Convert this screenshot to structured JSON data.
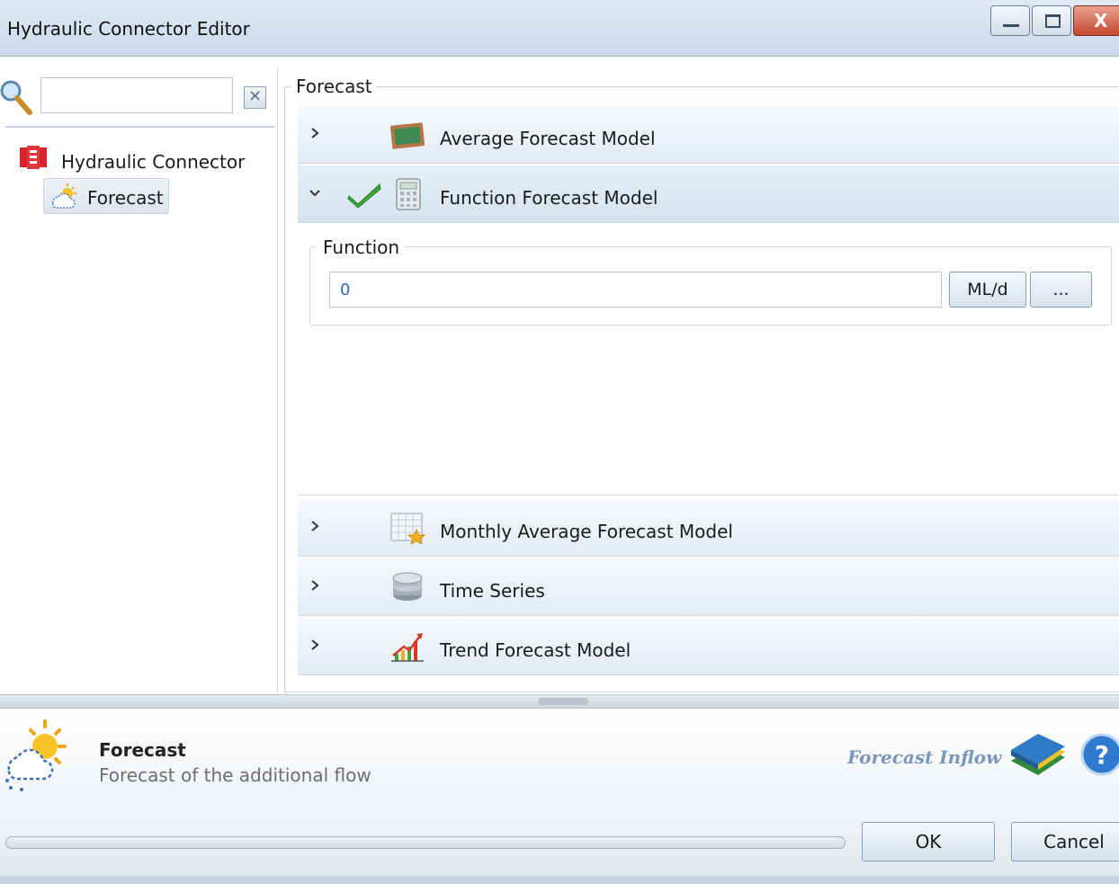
{
  "window": {
    "title": "Hydraulic Connector Editor",
    "close_glyph": "X"
  },
  "search": {
    "placeholder": "",
    "value": "",
    "clear_glyph": "✕"
  },
  "tree": {
    "root_label": "Hydraulic Connector",
    "child_label": "Forecast"
  },
  "forecast_group": {
    "title": "Forecast",
    "models": [
      {
        "label": "Average Forecast Model",
        "expanded": false,
        "icon": "chalkboard-icon"
      },
      {
        "label": "Function Forecast Model",
        "expanded": true,
        "selected": true,
        "icon": "calculator-icon"
      },
      {
        "label": "Monthly Average Forecast Model",
        "expanded": false,
        "icon": "calendar-star-icon"
      },
      {
        "label": "Time Series",
        "expanded": false,
        "icon": "database-icon"
      },
      {
        "label": "Trend Forecast Model",
        "expanded": false,
        "icon": "trend-chart-icon"
      }
    ],
    "function": {
      "title": "Function",
      "value": "0",
      "unit_label": "ML/d",
      "more_label": "..."
    }
  },
  "info": {
    "title": "Forecast",
    "subtitle": "Forecast of the additional flow",
    "link": "Forecast Inflow"
  },
  "buttons": {
    "ok": "OK",
    "cancel": "Cancel"
  },
  "colors": {
    "accent": "#2b6bb5",
    "header_bg": "#e3ebf3",
    "check_green": "#3ea83a"
  }
}
